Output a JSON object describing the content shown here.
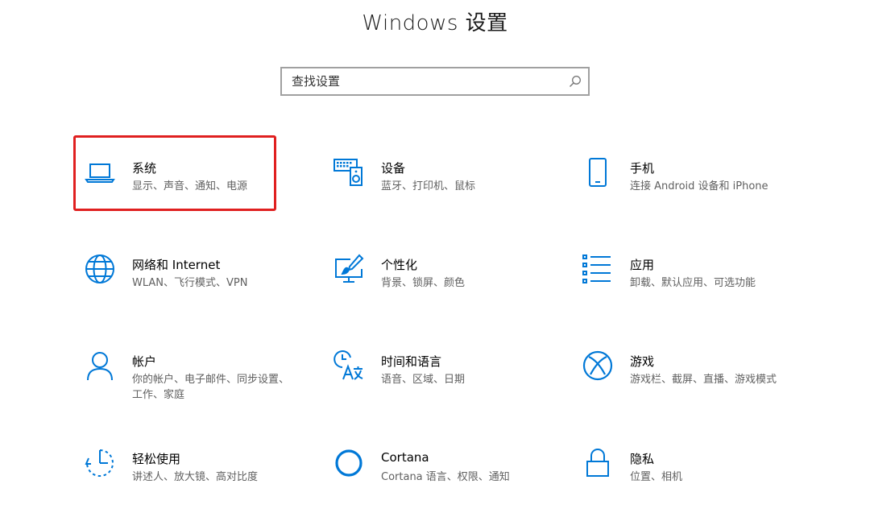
{
  "window": {
    "title": "Windows 设置"
  },
  "search": {
    "placeholder": "查找设置"
  },
  "accent": "#0078d7",
  "highlight_color": "#e02020",
  "tiles": [
    {
      "name": "系统",
      "desc": "显示、声音、通知、电源",
      "icon": "laptop-icon"
    },
    {
      "name": "设备",
      "desc": "蓝牙、打印机、鼠标",
      "icon": "keyboard-speaker-icon"
    },
    {
      "name": "手机",
      "desc": "连接 Android 设备和 iPhone",
      "icon": "phone-icon"
    },
    {
      "name": "网络和 Internet",
      "desc": "WLAN、飞行模式、VPN",
      "icon": "globe-icon"
    },
    {
      "name": "个性化",
      "desc": "背景、锁屏、颜色",
      "icon": "paint-monitor-icon"
    },
    {
      "name": "应用",
      "desc": "卸载、默认应用、可选功能",
      "icon": "apps-list-icon"
    },
    {
      "name": "帐户",
      "desc": "你的帐户、电子邮件、同步设置、工作、家庭",
      "icon": "person-icon"
    },
    {
      "name": "时间和语言",
      "desc": "语音、区域、日期",
      "icon": "time-language-icon"
    },
    {
      "name": "游戏",
      "desc": "游戏栏、截屏、直播、游戏模式",
      "icon": "xbox-icon"
    },
    {
      "name": "轻松使用",
      "desc": "讲述人、放大镜、高对比度",
      "icon": "ease-of-access-icon"
    },
    {
      "name": "Cortana",
      "desc": "Cortana 语言、权限、通知",
      "icon": "cortana-ring-icon"
    },
    {
      "name": "隐私",
      "desc": "位置、相机",
      "icon": "lock-icon"
    }
  ]
}
